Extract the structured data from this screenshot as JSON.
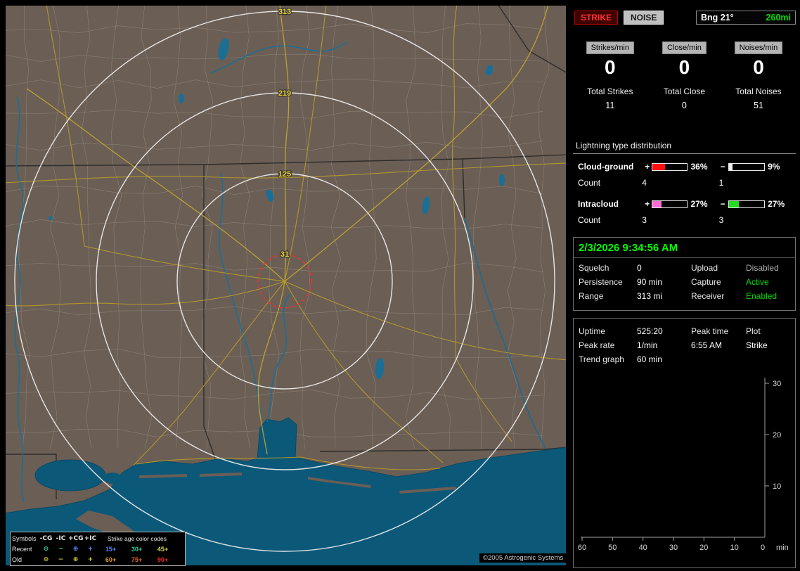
{
  "map": {
    "ring_labels": [
      "313",
      "219",
      "125",
      "31"
    ],
    "copyright": "©2005 Astrogenic Systems",
    "colors": {
      "land": "#6b5e55",
      "water": "#0c5878",
      "road": "#b49b2a",
      "range_ring": "#ececec",
      "alarm_ring": "#ff2a2a"
    },
    "legend": {
      "symbols_title": "Symbols",
      "columns": [
        "-CG",
        "-IC",
        "+CG",
        "+IC"
      ],
      "age_title": "Strike age color codes",
      "recent": {
        "label": "Recent",
        "symbols": [
          {
            "glyph": "⊖",
            "color": "#2fd4a6"
          },
          {
            "glyph": "−",
            "color": "#2fd4a6"
          },
          {
            "glyph": "⊕",
            "color": "#5588ff"
          },
          {
            "glyph": "+",
            "color": "#5588ff"
          }
        ],
        "ages": [
          {
            "text": "15+",
            "color": "#5588ff"
          },
          {
            "text": "30+",
            "color": "#2fd4a6"
          },
          {
            "text": "45+",
            "color": "#d8d840"
          }
        ]
      },
      "old": {
        "label": "Old",
        "symbols": [
          {
            "glyph": "⊖",
            "color": "#d8c838"
          },
          {
            "glyph": "−",
            "color": "#d8c838"
          },
          {
            "glyph": "⊕",
            "color": "#d8c838"
          },
          {
            "glyph": "+",
            "color": "#d8c838"
          }
        ],
        "ages": [
          {
            "text": "60+",
            "color": "#e09a28"
          },
          {
            "text": "75+",
            "color": "#e55f1d"
          },
          {
            "text": "90+",
            "color": "#ef2626"
          }
        ]
      }
    }
  },
  "panel": {
    "strike_button": "STRIKE",
    "noise_button": "NOISE",
    "bearing": "Bng 21°",
    "bearing_range": "260mi",
    "counters": [
      {
        "badge": "Strikes/min",
        "value": "0",
        "total_label": "Total Strikes",
        "total": "11"
      },
      {
        "badge": "Close/min",
        "value": "0",
        "total_label": "Total Close",
        "total": "0"
      },
      {
        "badge": "Noises/min",
        "value": "0",
        "total_label": "Total Noises",
        "total": "51"
      }
    ],
    "distribution": {
      "title": "Lightning type distribution",
      "plus": "+",
      "minus": "−",
      "count_label": "Count",
      "rows": [
        {
          "label": "Cloud-ground",
          "pos_pct": "36%",
          "pos_val": 36,
          "pos_color": "#ff1010",
          "neg_pct": "9%",
          "neg_val": 9,
          "neg_color": "#f0f0f0",
          "pos_count": "4",
          "neg_count": "1"
        },
        {
          "label": "Intracloud",
          "pos_pct": "27%",
          "pos_val": 27,
          "pos_color": "#ff6ad5",
          "neg_pct": "27%",
          "neg_val": 27,
          "neg_color": "#22dd22",
          "pos_count": "3",
          "neg_count": "3"
        }
      ]
    },
    "clock": {
      "datetime": "2/3/2026 9:34:56 AM",
      "rows": [
        {
          "l1": "Squelch",
          "v1": "0",
          "l2": "Upload",
          "v2": "Disabled",
          "v2_color": "#b0b0b0"
        },
        {
          "l1": "Persistence",
          "v1": "90 min",
          "l2": "Capture",
          "v2": "Active",
          "v2_color": "#00dd00"
        },
        {
          "l1": "Range",
          "v1": "313 mi",
          "l2": "Receiver",
          "v2": "Enabled",
          "v2_color": "#00dd00"
        }
      ]
    },
    "stats": {
      "uptime_label": "Uptime",
      "uptime": "525:20",
      "peak_time_label": "Peak time",
      "plot_label": "Plot",
      "peak_rate_label": "Peak rate",
      "peak_rate": "1/min",
      "peak_time": "6:55 AM",
      "plot_value": "Strike",
      "trend_label": "Trend graph",
      "trend_window": "60 min",
      "graph": {
        "y_ticks": [
          "30",
          "20",
          "10"
        ],
        "x_ticks": [
          "60",
          "50",
          "40",
          "30",
          "20",
          "10",
          "0"
        ],
        "x_unit": "min"
      }
    }
  }
}
